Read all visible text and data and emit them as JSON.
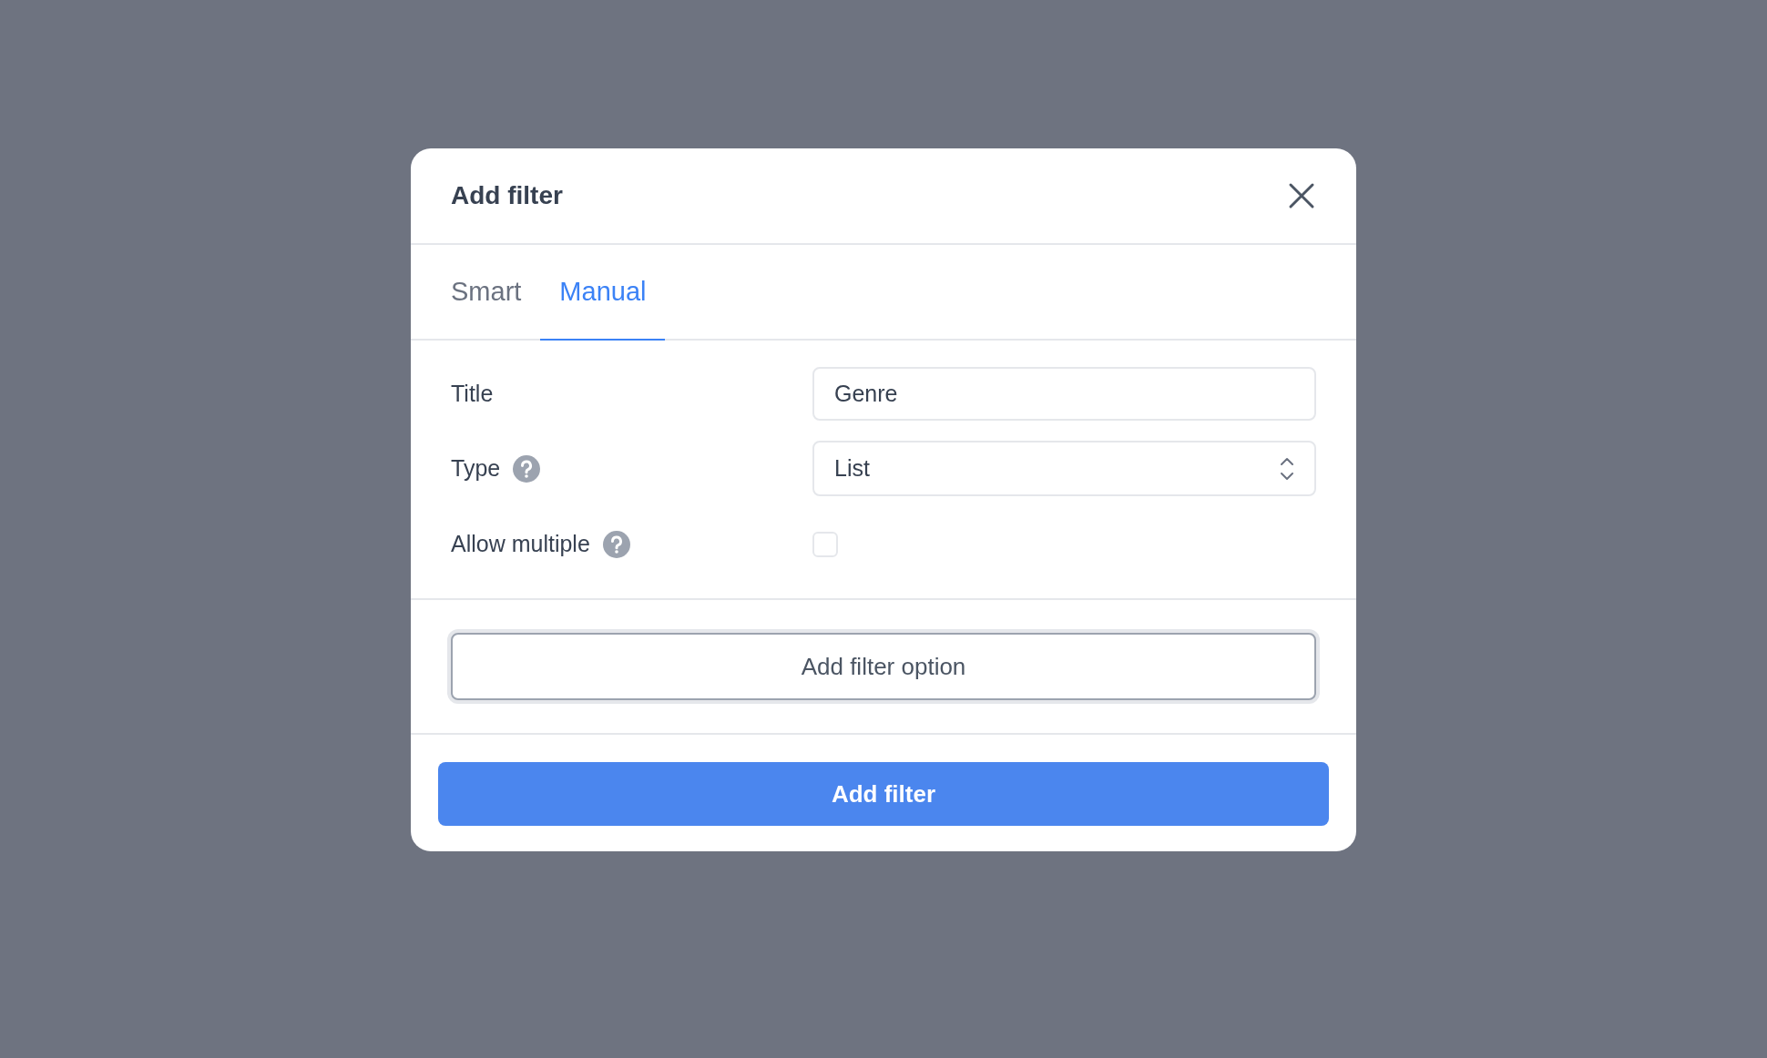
{
  "dialog": {
    "title": "Add filter",
    "tabs": [
      {
        "label": "Smart",
        "selected": false
      },
      {
        "label": "Manual",
        "selected": true
      }
    ],
    "fields": [
      {
        "kind": "text",
        "label": "Title",
        "help": false,
        "value": "Genre"
      },
      {
        "kind": "select",
        "label": "Type",
        "help": true,
        "value": "List"
      },
      {
        "kind": "checkbox",
        "label": "Allow multiple",
        "help": true,
        "checked": false
      }
    ],
    "option_button": "Add filter option",
    "submit_button": "Add filter"
  }
}
